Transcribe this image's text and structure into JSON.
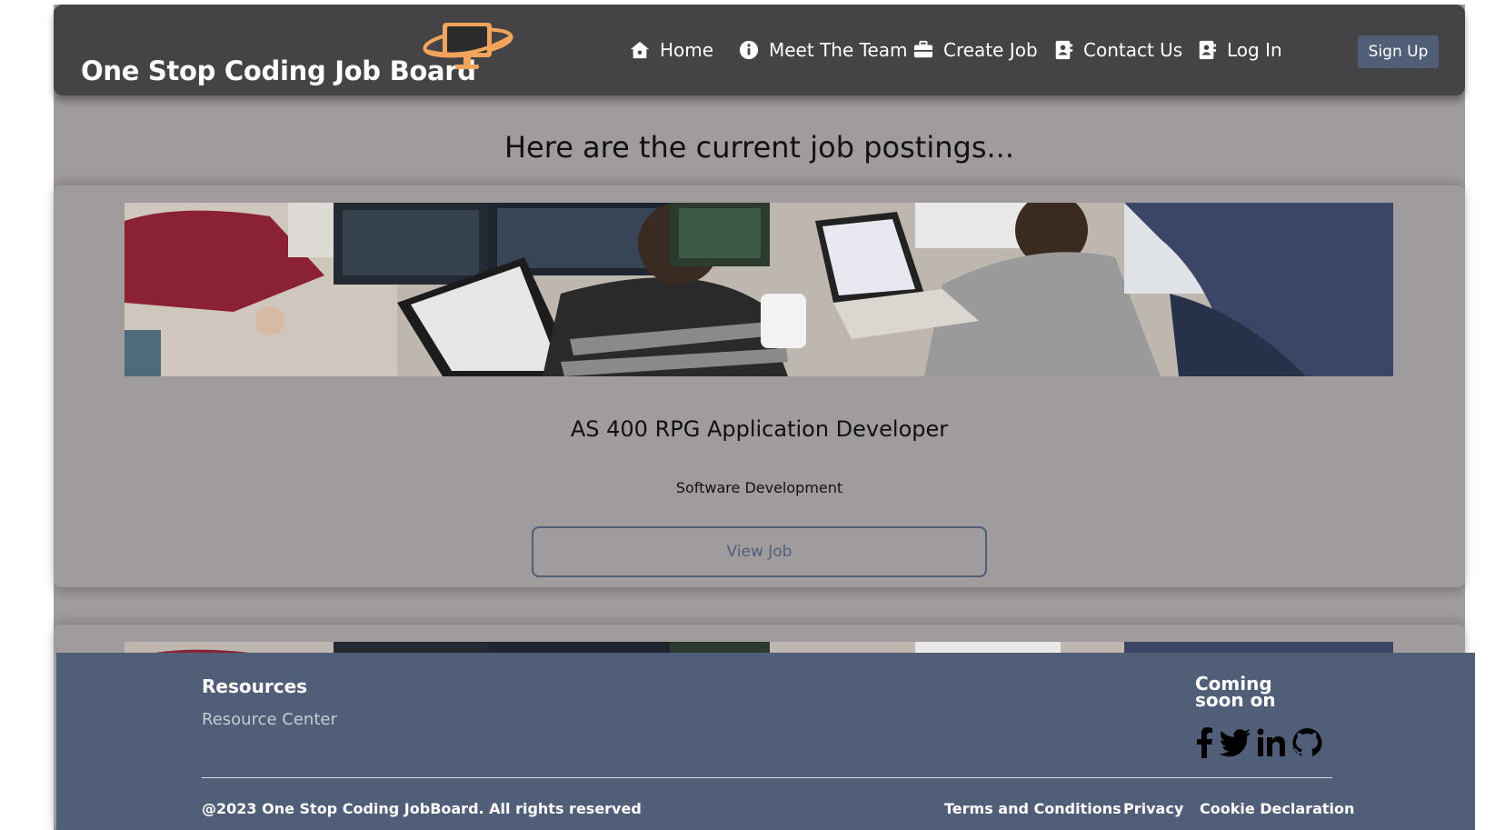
{
  "navbar": {
    "brand": "One Stop Coding Job Board",
    "logo_icon": "monitor-logo-icon",
    "accent_color": "#f0a45c",
    "items": [
      {
        "label": "Home",
        "icon": "home-icon"
      },
      {
        "label": "Meet The Team",
        "icon": "info-icon"
      },
      {
        "label": "Create Job",
        "icon": "briefcase-icon"
      },
      {
        "label": "Contact Us",
        "icon": "contact-book-icon"
      },
      {
        "label": "Log In",
        "icon": "login-icon"
      }
    ],
    "signup_label": "Sign Up"
  },
  "main": {
    "heading": "Here are the current job postings...",
    "jobs": [
      {
        "title": "AS 400 RPG Application Developer",
        "category": "Software Development",
        "button_label": "View Job"
      }
    ]
  },
  "footer": {
    "resources_title": "Resources",
    "resource_link": "Resource Center",
    "coming_soon": "Coming soon on",
    "social_icons": [
      "facebook-icon",
      "twitter-icon",
      "linkedin-icon",
      "github-icon"
    ],
    "copyright": "@2023 One Stop Coding JobBoard. All rights reserved",
    "links": [
      "Terms and Conditions",
      "Privacy",
      "Cookie Declaration"
    ]
  },
  "colors": {
    "navbar_bg": "#454345",
    "page_bg": "#a09b9c",
    "footer_bg": "#515e78",
    "button_bg": "#515e78"
  }
}
